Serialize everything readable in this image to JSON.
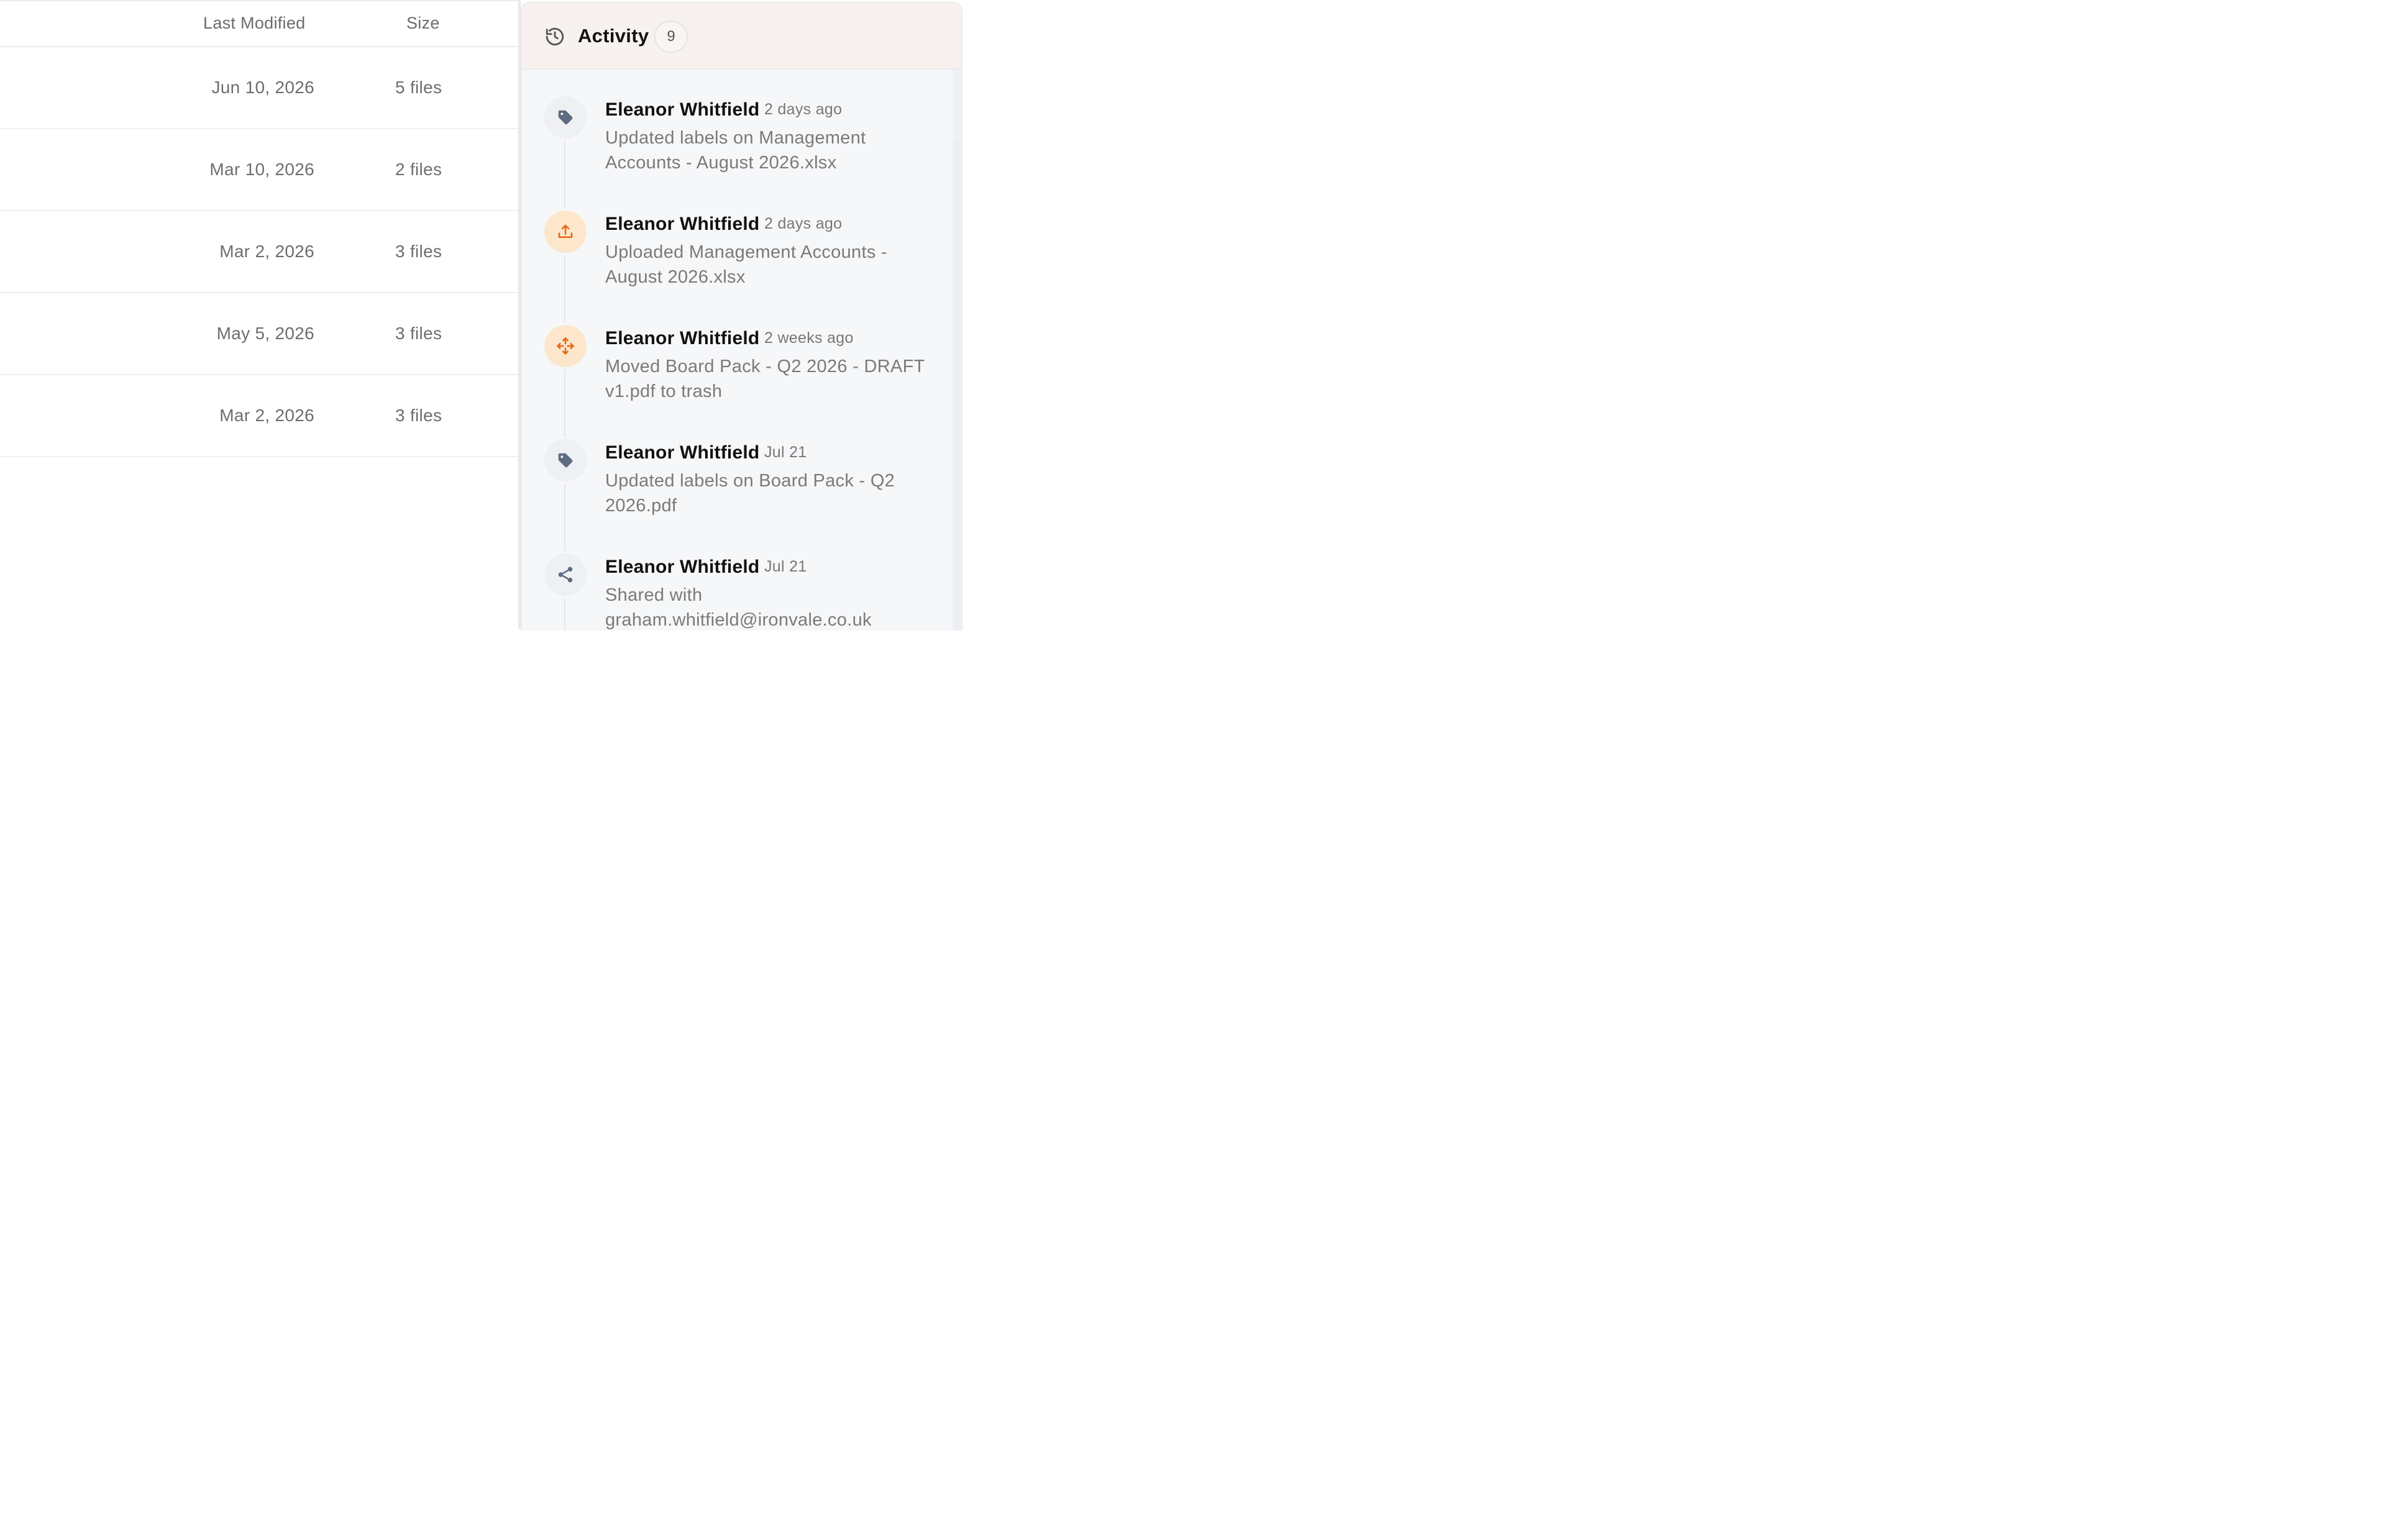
{
  "table": {
    "headers": {
      "last_modified": "Last Modified",
      "size": "Size"
    },
    "rows": [
      {
        "modified": "Jun 10, 2026",
        "size": "5 files"
      },
      {
        "modified": "Mar 10, 2026",
        "size": "2 files"
      },
      {
        "modified": "Mar 2, 2026",
        "size": "3 files"
      },
      {
        "modified": "May 5, 2026",
        "size": "3 files"
      },
      {
        "modified": "Mar 2, 2026",
        "size": "3 files"
      }
    ]
  },
  "activity": {
    "title": "Activity",
    "count": "9",
    "header_icon": "history-icon",
    "events": [
      {
        "icon": "tag-icon",
        "author": "Eleanor Whitfield",
        "time": "2 days ago",
        "description": "Updated labels on Management Accounts - August 2026.xlsx"
      },
      {
        "icon": "upload-icon",
        "author": "Eleanor Whitfield",
        "time": "2 days ago",
        "description": "Uploaded Management Accounts - August 2026.xlsx"
      },
      {
        "icon": "move-icon",
        "author": "Eleanor Whitfield",
        "time": "2 weeks ago",
        "description": "Moved Board Pack - Q2 2026 - DRAFT v1.pdf to trash"
      },
      {
        "icon": "tag-icon",
        "author": "Eleanor Whitfield",
        "time": "Jul 21",
        "description": "Updated labels on Board Pack - Q2 2026.pdf"
      },
      {
        "icon": "share-icon",
        "author": "Eleanor Whitfield",
        "time": "Jul 21",
        "description": "Shared with graham.whitfield@ironvale.co.uk"
      }
    ]
  },
  "colors": {
    "accent_orange": "#e8650f",
    "icon_slate": "#5f6b80",
    "warm_icon_bg": "#fde7cc",
    "header_bg": "#f7f2ef"
  }
}
